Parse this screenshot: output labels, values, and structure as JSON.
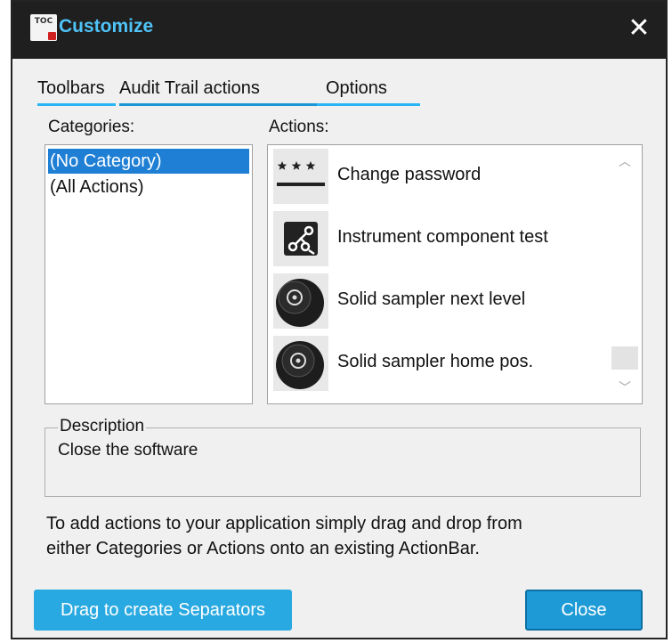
{
  "window": {
    "title": "Customize",
    "icon_text": "TOC",
    "close_glyph": "✕"
  },
  "tabs": [
    {
      "label": "Toolbars"
    },
    {
      "label": "Audit Trail actions"
    },
    {
      "label": "Options"
    }
  ],
  "categories": {
    "label": "Categories:",
    "items": [
      {
        "label": "(No Category)",
        "selected": true
      },
      {
        "label": "(All Actions)",
        "selected": false
      }
    ]
  },
  "actions": {
    "label": "Actions:",
    "items": [
      {
        "label": "Change password",
        "icon": "password-stars-icon"
      },
      {
        "label": "Instrument component test",
        "icon": "component-test-icon"
      },
      {
        "label": "Solid sampler next level",
        "icon": "solid-sampler-icon"
      },
      {
        "label": "Solid sampler home pos.",
        "icon": "solid-sampler-home-icon"
      }
    ]
  },
  "description": {
    "title": "Description",
    "text": "Close the software"
  },
  "hint": {
    "line1": "To add actions to your application simply drag and drop from",
    "line2": "either Categories or Actions onto an existing ActionBar."
  },
  "buttons": {
    "separators": "Drag to create Separators",
    "close": "Close"
  },
  "colors": {
    "accent": "#29a9e1",
    "title_text": "#4fc3f7",
    "selection": "#1e7fd4",
    "titlebar": "#1f1f1f"
  }
}
